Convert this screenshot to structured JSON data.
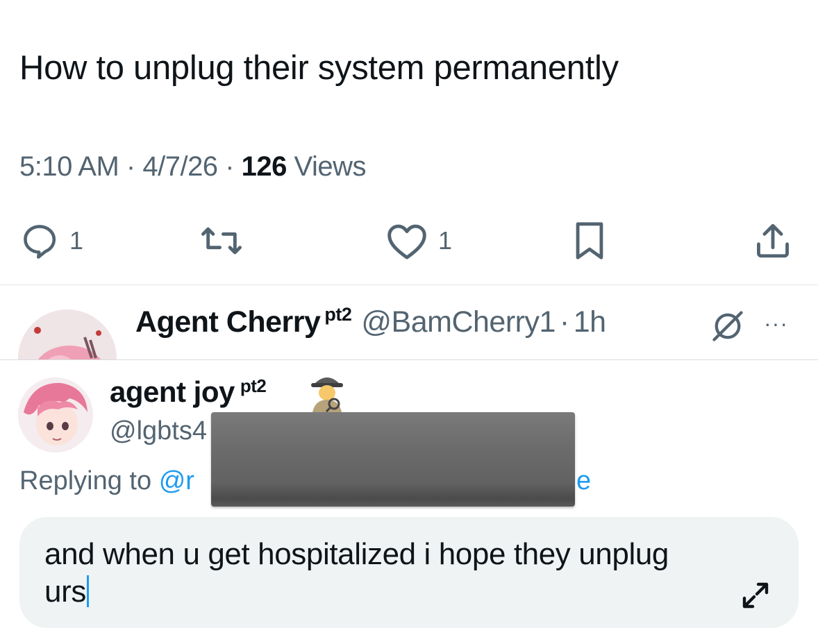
{
  "tweet": {
    "text": "How to unplug their system permanently",
    "time": "5:10 AM",
    "date": "4/7/26",
    "views_count": "126",
    "views_label": "Views",
    "separator": "·"
  },
  "actions": {
    "reply_count": "1",
    "like_count": "1",
    "icons": [
      "reply-icon",
      "retweet-icon",
      "like-icon",
      "bookmark-icon",
      "share-icon"
    ]
  },
  "reply": {
    "name": "Agent Cherry",
    "badge": "pt2",
    "handle": "@BamCherry1",
    "time_ago": "1h",
    "separator": "·",
    "more": "···"
  },
  "composer": {
    "name": "agent joy",
    "badge": "pt2",
    "handle_partial": "@lgbts4",
    "replying_label": "Replying to",
    "replying_handle_partial": "@r",
    "replying_tail": "e",
    "input_text": "and when u get hospitalized i hope they unplug urs"
  },
  "colors": {
    "accent": "#1d9bf0",
    "text": "#0f1419",
    "muted": "#536471",
    "input_bg": "#eff3f4"
  }
}
